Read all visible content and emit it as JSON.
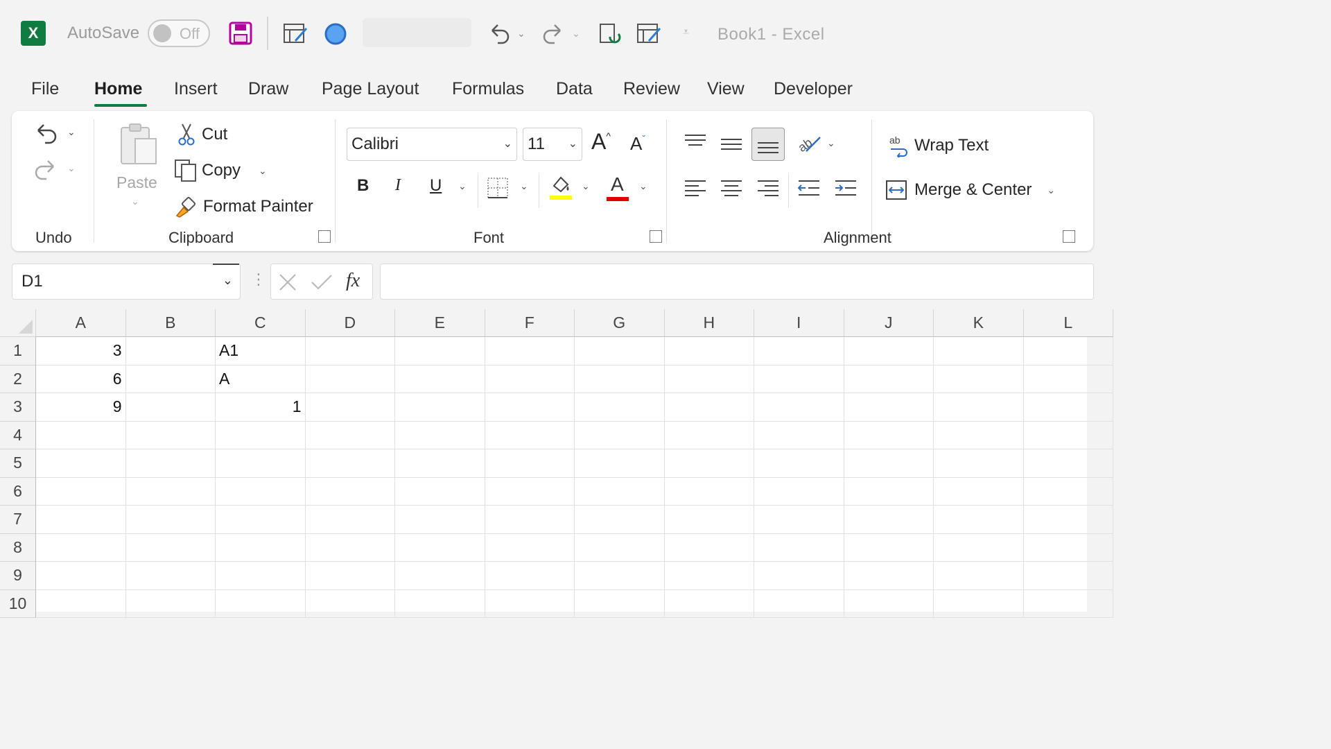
{
  "titlebar": {
    "autosave_label": "AutoSave",
    "autosave_state": "Off",
    "doc_title": "Book1  -  Excel",
    "excel_logo_letter": "X"
  },
  "menu": {
    "tabs": [
      "File",
      "Home",
      "Insert",
      "Draw",
      "Page Layout",
      "Formulas",
      "Data",
      "Review",
      "View",
      "Developer"
    ],
    "active_tab": "Home"
  },
  "ribbon": {
    "undo_group": "Undo",
    "clipboard": {
      "group": "Clipboard",
      "paste": "Paste",
      "cut": "Cut",
      "copy": "Copy",
      "format_painter": "Format Painter"
    },
    "font": {
      "group": "Font",
      "name": "Calibri",
      "size": "11",
      "bold": "B",
      "italic": "I",
      "underline": "U",
      "grow": "A",
      "shrink": "A",
      "font_color_glyph": "A",
      "highlight_color": "#ffff00",
      "font_color": "#e00000"
    },
    "alignment": {
      "group": "Alignment",
      "wrap_text": "Wrap Text",
      "merge_center": "Merge & Center",
      "wrap_icon_text": "ab"
    }
  },
  "formula_bar": {
    "name_box": "D1",
    "fx": "fx",
    "formula": ""
  },
  "sheet": {
    "columns": [
      "A",
      "B",
      "C",
      "D",
      "E",
      "F",
      "G",
      "H",
      "I",
      "J",
      "K",
      "L"
    ],
    "rows": [
      "1",
      "2",
      "3",
      "4",
      "5",
      "6",
      "7",
      "8",
      "9",
      "10"
    ],
    "cells": {
      "A1": "3",
      "A2": "6",
      "A3": "9",
      "C1": "A1",
      "C2": "A",
      "C3": "1"
    }
  },
  "colors": {
    "accent": "#107c41"
  }
}
